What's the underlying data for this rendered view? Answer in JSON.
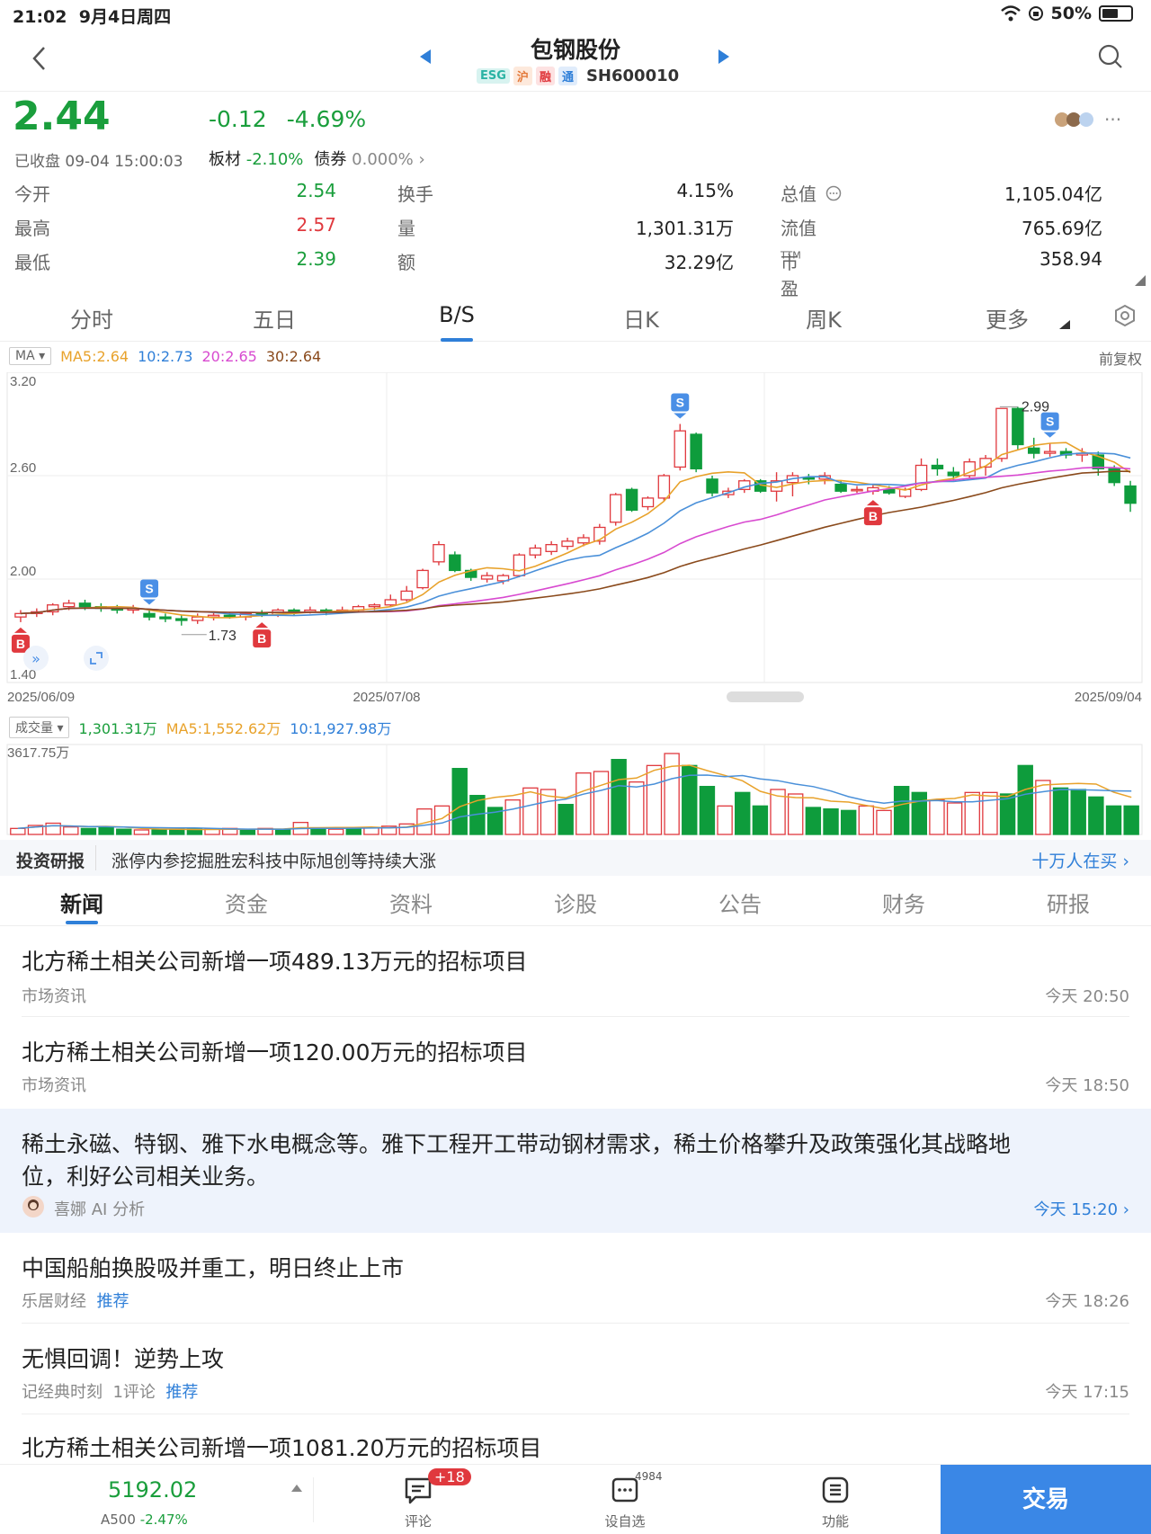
{
  "status": {
    "time": "21:02",
    "date": "9月4日周四",
    "battery": "50%"
  },
  "nav": {
    "title": "包钢股份",
    "tags": [
      "ESG",
      "沪",
      "融",
      "通"
    ],
    "code": "SH600010"
  },
  "quote": {
    "price": "2.44",
    "change": "-0.12",
    "change_pct": "-4.69%",
    "closed_label": "已收盘 09-04 15:00:03",
    "sector_label": "板材",
    "sector_value": "-2.10%",
    "bond_label": "债券",
    "bond_value": "0.000%",
    "stats": [
      {
        "l1": "今开",
        "v1": "2.54",
        "l2": "换手",
        "v2": "4.15%",
        "l3": "总值",
        "v3": "1,105.04亿"
      },
      {
        "l1": "最高",
        "v1": "2.57",
        "l2": "量",
        "v2": "1,301.31万",
        "l3": "流值",
        "v3": "765.69亿"
      },
      {
        "l1": "最低",
        "v1": "2.39",
        "l2": "额",
        "v2": "32.29亿",
        "l3": "市盈",
        "v3": "358.94",
        "ttm": "TTM"
      }
    ]
  },
  "ktabs": [
    "分时",
    "五日",
    "B/S",
    "日K",
    "周K",
    "更多"
  ],
  "chart_legend": {
    "ma": "MA",
    "ma5": "MA5:2.64",
    "ma10": "10:2.73",
    "ma20": "20:2.65",
    "ma30": "30:2.64",
    "adj": "前复权"
  },
  "vol_legend": {
    "label": "成交量",
    "vol": "1,301.31万",
    "ma5": "MA5:1,552.62万",
    "ma10": "10:1,927.98万",
    "max": "3617.75万"
  },
  "chart_data": {
    "type": "candlestick",
    "ylim": [
      1.4,
      3.2
    ],
    "yticks": [
      "3.20",
      "2.60",
      "2.00",
      "1.40"
    ],
    "xticks": [
      "2025/06/09",
      "2025/07/08",
      "2025/09/04"
    ],
    "high_label": "2.99",
    "low_label": "1.73",
    "candles": [
      [
        1.78,
        1.8,
        1.75,
        1.82
      ],
      [
        1.8,
        1.81,
        1.78,
        1.83
      ],
      [
        1.81,
        1.85,
        1.79,
        1.86
      ],
      [
        1.84,
        1.86,
        1.82,
        1.88
      ],
      [
        1.86,
        1.84,
        1.82,
        1.88
      ],
      [
        1.84,
        1.83,
        1.81,
        1.86
      ],
      [
        1.83,
        1.82,
        1.8,
        1.85
      ],
      [
        1.82,
        1.83,
        1.8,
        1.85
      ],
      [
        1.8,
        1.78,
        1.76,
        1.82
      ],
      [
        1.78,
        1.77,
        1.75,
        1.8
      ],
      [
        1.77,
        1.76,
        1.73,
        1.79
      ],
      [
        1.76,
        1.78,
        1.74,
        1.8
      ],
      [
        1.78,
        1.79,
        1.76,
        1.81
      ],
      [
        1.79,
        1.78,
        1.77,
        1.81
      ],
      [
        1.78,
        1.8,
        1.76,
        1.81
      ],
      [
        1.8,
        1.79,
        1.78,
        1.82
      ],
      [
        1.79,
        1.82,
        1.78,
        1.83
      ],
      [
        1.82,
        1.81,
        1.79,
        1.83
      ],
      [
        1.81,
        1.82,
        1.8,
        1.84
      ],
      [
        1.82,
        1.81,
        1.79,
        1.83
      ],
      [
        1.81,
        1.82,
        1.8,
        1.84
      ],
      [
        1.82,
        1.84,
        1.81,
        1.85
      ],
      [
        1.84,
        1.85,
        1.82,
        1.86
      ],
      [
        1.85,
        1.88,
        1.84,
        1.91
      ],
      [
        1.88,
        1.93,
        1.87,
        1.96
      ],
      [
        1.95,
        2.05,
        1.94,
        2.06
      ],
      [
        2.1,
        2.2,
        2.08,
        2.22
      ],
      [
        2.14,
        2.05,
        2.04,
        2.16
      ],
      [
        2.05,
        2.01,
        1.99,
        2.06
      ],
      [
        2.0,
        2.02,
        1.98,
        2.04
      ],
      [
        1.99,
        2.02,
        1.97,
        2.03
      ],
      [
        2.02,
        2.14,
        2.01,
        2.15
      ],
      [
        2.14,
        2.18,
        2.12,
        2.2
      ],
      [
        2.16,
        2.2,
        2.14,
        2.22
      ],
      [
        2.19,
        2.22,
        2.17,
        2.24
      ],
      [
        2.21,
        2.24,
        2.19,
        2.26
      ],
      [
        2.22,
        2.3,
        2.2,
        2.32
      ],
      [
        2.33,
        2.49,
        2.31,
        2.5
      ],
      [
        2.52,
        2.4,
        2.39,
        2.53
      ],
      [
        2.42,
        2.47,
        2.4,
        2.48
      ],
      [
        2.47,
        2.6,
        2.45,
        2.61
      ],
      [
        2.65,
        2.86,
        2.63,
        2.9
      ],
      [
        2.84,
        2.64,
        2.62,
        2.85
      ],
      [
        2.58,
        2.5,
        2.48,
        2.6
      ],
      [
        2.49,
        2.51,
        2.47,
        2.53
      ],
      [
        2.52,
        2.57,
        2.5,
        2.58
      ],
      [
        2.57,
        2.51,
        2.5,
        2.58
      ],
      [
        2.51,
        2.57,
        2.45,
        2.62
      ],
      [
        2.56,
        2.6,
        2.48,
        2.62
      ],
      [
        2.59,
        2.58,
        2.55,
        2.61
      ],
      [
        2.58,
        2.6,
        2.55,
        2.62
      ],
      [
        2.55,
        2.51,
        2.5,
        2.57
      ],
      [
        2.52,
        2.52,
        2.5,
        2.54
      ],
      [
        2.51,
        2.53,
        2.49,
        2.55
      ],
      [
        2.52,
        2.5,
        2.49,
        2.54
      ],
      [
        2.48,
        2.52,
        2.47,
        2.53
      ],
      [
        2.52,
        2.66,
        2.51,
        2.7
      ],
      [
        2.66,
        2.64,
        2.6,
        2.7
      ],
      [
        2.62,
        2.6,
        2.57,
        2.65
      ],
      [
        2.6,
        2.68,
        2.58,
        2.7
      ],
      [
        2.65,
        2.7,
        2.6,
        2.72
      ],
      [
        2.7,
        2.99,
        2.68,
        2.99
      ],
      [
        2.99,
        2.78,
        2.75,
        3.0
      ],
      [
        2.76,
        2.73,
        2.7,
        2.82
      ],
      [
        2.73,
        2.74,
        2.71,
        2.79
      ],
      [
        2.74,
        2.72,
        2.7,
        2.76
      ],
      [
        2.72,
        2.73,
        2.68,
        2.76
      ],
      [
        2.72,
        2.64,
        2.6,
        2.74
      ],
      [
        2.64,
        2.56,
        2.54,
        2.66
      ],
      [
        2.54,
        2.44,
        2.39,
        2.57
      ]
    ],
    "volumes": [
      [
        0.08,
        1
      ],
      [
        0.12,
        1
      ],
      [
        0.15,
        1
      ],
      [
        0.1,
        1
      ],
      [
        0.08,
        0
      ],
      [
        0.09,
        0
      ],
      [
        0.07,
        0
      ],
      [
        0.06,
        1
      ],
      [
        0.06,
        0
      ],
      [
        0.07,
        0
      ],
      [
        0.07,
        0
      ],
      [
        0.07,
        1
      ],
      [
        0.08,
        1
      ],
      [
        0.06,
        0
      ],
      [
        0.08,
        1
      ],
      [
        0.07,
        0
      ],
      [
        0.16,
        1
      ],
      [
        0.08,
        0
      ],
      [
        0.07,
        1
      ],
      [
        0.09,
        0
      ],
      [
        0.09,
        1
      ],
      [
        0.11,
        1
      ],
      [
        0.14,
        1
      ],
      [
        0.34,
        1
      ],
      [
        0.38,
        1
      ],
      [
        0.88,
        0
      ],
      [
        0.52,
        0
      ],
      [
        0.36,
        0
      ],
      [
        0.46,
        1
      ],
      [
        0.62,
        1
      ],
      [
        0.6,
        1
      ],
      [
        0.4,
        0
      ],
      [
        0.82,
        1
      ],
      [
        0.84,
        1
      ],
      [
        1.0,
        0
      ],
      [
        0.7,
        1
      ],
      [
        0.92,
        1
      ],
      [
        1.08,
        1
      ],
      [
        0.92,
        0
      ],
      [
        0.64,
        0
      ],
      [
        0.38,
        1
      ],
      [
        0.56,
        0
      ],
      [
        0.38,
        0
      ],
      [
        0.6,
        1
      ],
      [
        0.54,
        1
      ],
      [
        0.36,
        0
      ],
      [
        0.34,
        0
      ],
      [
        0.32,
        0
      ],
      [
        0.38,
        1
      ],
      [
        0.32,
        1
      ],
      [
        0.64,
        0
      ],
      [
        0.56,
        0
      ],
      [
        0.46,
        1
      ],
      [
        0.42,
        1
      ],
      [
        0.56,
        1
      ],
      [
        0.56,
        1
      ],
      [
        0.54,
        0
      ],
      [
        0.92,
        0
      ],
      [
        0.72,
        1
      ],
      [
        0.62,
        0
      ],
      [
        0.6,
        0
      ],
      [
        0.5,
        0
      ],
      [
        0.38,
        0
      ],
      [
        0.38,
        0
      ]
    ]
  },
  "research": {
    "label": "投资研报",
    "headline": "涨停内参挖掘胜宏科技中际旭创等持续大涨",
    "link": "十万人在买"
  },
  "ntabs": [
    "新闻",
    "资金",
    "资料",
    "诊股",
    "公告",
    "财务",
    "研报"
  ],
  "news": [
    {
      "title": "北方稀土相关公司新增一项489.13万元的招标项目",
      "source": "市场资讯",
      "time": "今天 20:50"
    },
    {
      "title": "北方稀土相关公司新增一项120.00万元的招标项目",
      "source": "市场资讯",
      "time": "今天 18:50"
    },
    {
      "title1": "稀土永磁、特钢、雅下水电概念等。雅下工程开工带动钢材需求，稀土价格攀升及政策强化其战略地",
      "title2": "位，利好公司相关业务。",
      "source": "喜娜 AI 分析",
      "time": "今天 15:20"
    },
    {
      "title": "中国船舶换股吸并重工，明日终止上市",
      "source": "乐居财经",
      "rec": "推荐",
      "time": "今天 18:26"
    },
    {
      "title": "无惧回调！逆势上攻",
      "source": "记经典时刻",
      "comments": "1评论",
      "rec": "推荐",
      "time": "今天 17:15"
    },
    {
      "title": "北方稀土相关公司新增一项1081.20万元的招标项目"
    }
  ],
  "bottom": {
    "index_value": "5192.02",
    "index_name": "A500",
    "index_chg": "-2.47%",
    "comment": "评论",
    "comment_badge": "+18",
    "watch": "设自选",
    "watch_count": "4984",
    "func": "功能",
    "trade": "交易"
  }
}
